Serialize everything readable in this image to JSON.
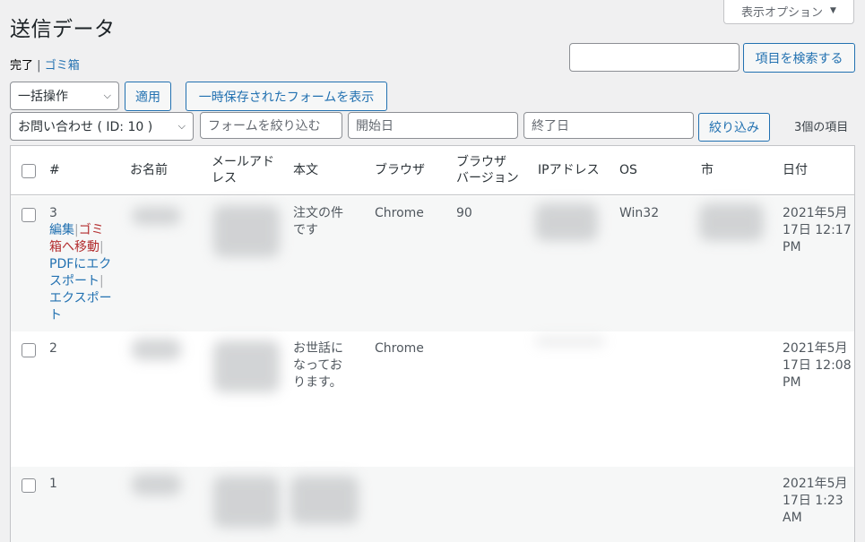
{
  "screen_options": {
    "label": "表示オプション"
  },
  "title": "送信データ",
  "filters_links": {
    "done": "完了",
    "sep": "|",
    "trash": "ゴミ箱"
  },
  "search": {
    "value": "",
    "button": "項目を検索する"
  },
  "bulk": {
    "selected": "一括操作",
    "apply": "適用"
  },
  "tmp_button": "一時保存されたフォームを表示",
  "form_select": "お問い合わせ ( ID: 10 )",
  "filter_form_placeholder": "フォームを絞り込む",
  "start_date_placeholder": "開始日",
  "end_date_placeholder": "終了日",
  "filter_button": "絞り込み",
  "item_count": "3個の項目",
  "columns": {
    "id": "#",
    "name": "お名前",
    "email_1": "メールアド",
    "email_2": "レス",
    "body": "本文",
    "browser": "ブラウザ",
    "browser_version_1": "ブラウザ",
    "browser_version_2": "バージョン",
    "ip": "IPアドレス",
    "os": "OS",
    "city": "市",
    "date": "日付"
  },
  "row_actions": {
    "edit": "編集",
    "trash_1": "ゴミ",
    "trash_2": "箱へ移動",
    "pdf_1": "PDFにエク",
    "pdf_2": "スポート",
    "export_1": "エクスポー",
    "export_2": "ト",
    "sep": "|"
  },
  "rows": [
    {
      "id": "3",
      "body_1": "注文の件",
      "body_2": "です",
      "body_3": "",
      "browser": "Chrome",
      "browser_version": "90",
      "os": "Win32",
      "date_1": "2021年5月",
      "date_2": "17日 12:17",
      "date_3": "PM"
    },
    {
      "id": "2",
      "body_1": "お世話に",
      "body_2": "なってお",
      "body_3": "ります。",
      "browser": "Chrome",
      "browser_version": "",
      "os": "",
      "date_1": "2021年5月",
      "date_2": "17日 12:08",
      "date_3": "PM"
    },
    {
      "id": "1",
      "body_1": "",
      "body_2": "",
      "body_3": "",
      "browser": "",
      "browser_version": "",
      "os": "",
      "date_1": "2021年5月",
      "date_2": "17日 1:23",
      "date_3": "AM"
    }
  ]
}
